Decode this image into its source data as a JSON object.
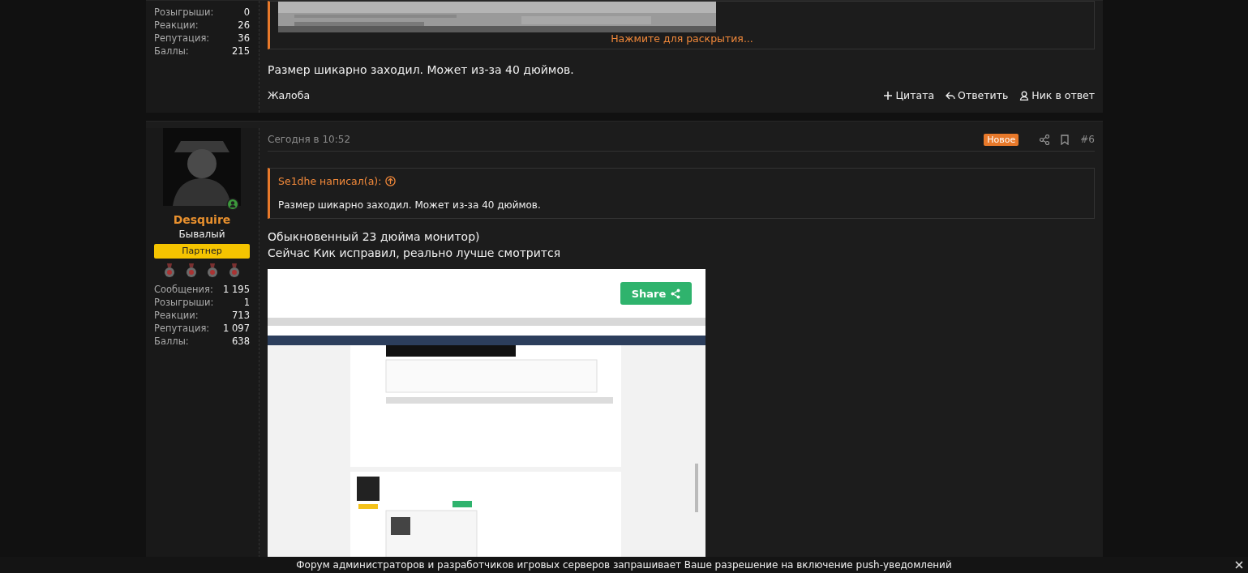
{
  "posts": [
    {
      "user": {
        "stats": [
          {
            "label": "Розыгрыши:",
            "value": "0"
          },
          {
            "label": "Реакции:",
            "value": "26"
          },
          {
            "label": "Репутация:",
            "value": "36"
          },
          {
            "label": "Баллы:",
            "value": "215"
          }
        ]
      },
      "quote": {
        "kind": "picture",
        "expand_link": "Нажмите для раскрытия..."
      },
      "body": [
        "Размер шикарно заходил. Может из-за 40 дюймов."
      ],
      "footer": {
        "report": "Жалоба",
        "actions": [
          {
            "kind": "plus",
            "label": "Цитата"
          },
          {
            "kind": "reply",
            "label": "Ответить"
          },
          {
            "kind": "user",
            "label": "Ник в ответ"
          }
        ]
      }
    },
    {
      "user": {
        "name": "Desquire",
        "title": "Бывалый",
        "banner": "Партнер",
        "online": true,
        "awards": [
          {
            "kind": "medal"
          },
          {
            "kind": "medal"
          },
          {
            "kind": "medal"
          },
          {
            "kind": "medal"
          }
        ],
        "stats": [
          {
            "label": "Сообщения:",
            "value": "1 195"
          },
          {
            "label": "Розыгрыши:",
            "value": "1"
          },
          {
            "label": "Реакции:",
            "value": "713"
          },
          {
            "label": "Репутация:",
            "value": "1 097"
          },
          {
            "label": "Баллы:",
            "value": "638"
          }
        ]
      },
      "header": {
        "date": "Сегодня в 10:52",
        "badge": "Новое",
        "number": "#6"
      },
      "quote": {
        "kind": "text",
        "author": "Se1dhe написал(а):",
        "text": "Размер шикарно заходил. Может из-за 40 дюймов."
      },
      "body": [
        "Обыкновенный 23 дюйма монитор)",
        "Сейчас Кик исправил, реально лучше смотрится"
      ],
      "embed": {
        "share": "Share",
        "kind": "picture"
      }
    }
  ],
  "notice": {
    "text": "Форум администраторов и разработчиков игровых серверов запрашивает Ваше разрешение на включение push-уведомлений"
  }
}
